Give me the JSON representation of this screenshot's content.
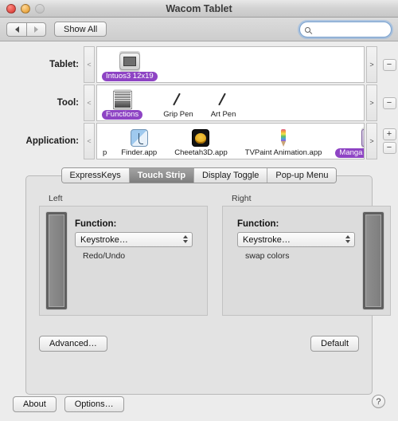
{
  "window": {
    "title": "Wacom Tablet",
    "traffic_lights": [
      "close",
      "minimize",
      "zoom"
    ]
  },
  "toolbar": {
    "back_label": "◀",
    "forward_label": "▶",
    "show_all_label": "Show All",
    "search_placeholder": "",
    "search_value": "",
    "search_icon": "search-icon"
  },
  "rows": [
    {
      "label": "Tablet:",
      "prev_arrow": "<",
      "next_arrow": ">",
      "buttons": [
        "−"
      ],
      "items": [
        {
          "label": "Intuos3 12x19",
          "icon": "tablet-icon",
          "selected": true
        }
      ]
    },
    {
      "label": "Tool:",
      "prev_arrow": "<",
      "next_arrow": ">",
      "buttons": [
        "−"
      ],
      "items": [
        {
          "label": "Functions",
          "icon": "functions-icon",
          "selected": true
        },
        {
          "label": "Grip Pen",
          "icon": "pen-icon",
          "selected": false
        },
        {
          "label": "Art Pen",
          "icon": "pen-icon",
          "selected": false
        }
      ]
    },
    {
      "label": "Application:",
      "prev_arrow": "<",
      "next_arrow": ">",
      "buttons": [
        "+",
        "−"
      ],
      "items": [
        {
          "label": "p",
          "icon": "truncated-app-icon",
          "selected": false
        },
        {
          "label": "Finder.app",
          "icon": "finder-icon",
          "selected": false
        },
        {
          "label": "Cheetah3D.app",
          "icon": "cheetah3d-icon",
          "selected": false
        },
        {
          "label": "TVPaint Animation.app",
          "icon": "tvpaint-icon",
          "selected": false
        },
        {
          "label": "Manga Studio.app",
          "icon": "manga-studio-icon",
          "selected": true
        }
      ]
    }
  ],
  "tabs": [
    {
      "label": "ExpressKeys",
      "active": false
    },
    {
      "label": "Touch Strip",
      "active": true
    },
    {
      "label": "Display Toggle",
      "active": false
    },
    {
      "label": "Pop-up Menu",
      "active": false
    }
  ],
  "panel": {
    "left": {
      "title": "Left",
      "function_label": "Function:",
      "function_value": "Keystroke…",
      "description": "Redo/Undo"
    },
    "right": {
      "title": "Right",
      "function_label": "Function:",
      "function_value": "Keystroke…",
      "description": "swap colors"
    },
    "advanced_label": "Advanced…",
    "default_label": "Default"
  },
  "footer": {
    "about_label": "About",
    "options_label": "Options…",
    "help_label": "?"
  },
  "colors": {
    "selection_purple": "#8e44c4",
    "window_bg": "#ececec",
    "panel_bg": "#e3e3e3",
    "tab_active": "#7e7e7e"
  }
}
